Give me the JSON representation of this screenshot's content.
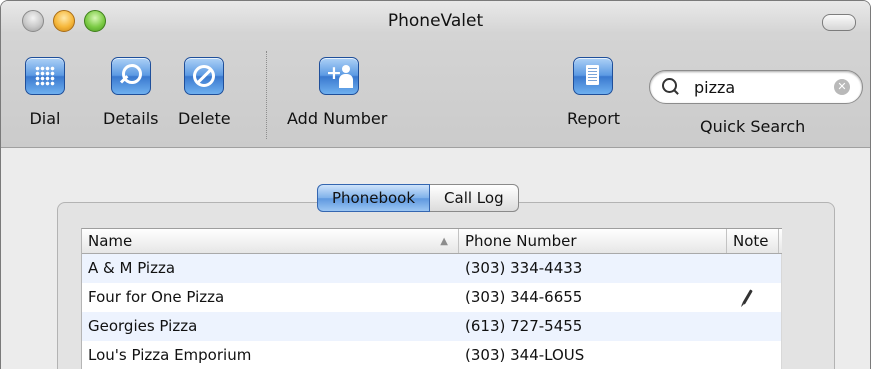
{
  "window": {
    "title": "PhoneValet"
  },
  "toolbar": {
    "dial": {
      "label": "Dial",
      "icon": "dial-keypad-icon"
    },
    "details": {
      "label": "Details",
      "icon": "magnifier-icon"
    },
    "delete": {
      "label": "Delete",
      "icon": "no-entry-icon"
    },
    "add_number": {
      "label": "Add Number",
      "icon": "add-person-icon"
    },
    "report": {
      "label": "Report",
      "icon": "document-icon"
    },
    "quick_search": {
      "label": "Quick Search",
      "value": "pizza"
    }
  },
  "tabs": [
    {
      "label": "Phonebook",
      "selected": true
    },
    {
      "label": "Call Log",
      "selected": false
    }
  ],
  "table": {
    "columns": {
      "name": "Name",
      "phone": "Phone Number",
      "note": "Note"
    },
    "rows": [
      {
        "name": "A & M Pizza",
        "phone": "(303) 334-4433",
        "note": false
      },
      {
        "name": "Four for One Pizza",
        "phone": "(303) 344-6655",
        "note": true
      },
      {
        "name": "Georgies Pizza",
        "phone": "(613) 727-5455",
        "note": false
      },
      {
        "name": "Lou's Pizza Emporium",
        "phone": "(303) 344-LOUS",
        "note": false
      }
    ]
  },
  "colors": {
    "accent_blue": "#5c9ae3",
    "row_alt": "#edf3fe"
  }
}
